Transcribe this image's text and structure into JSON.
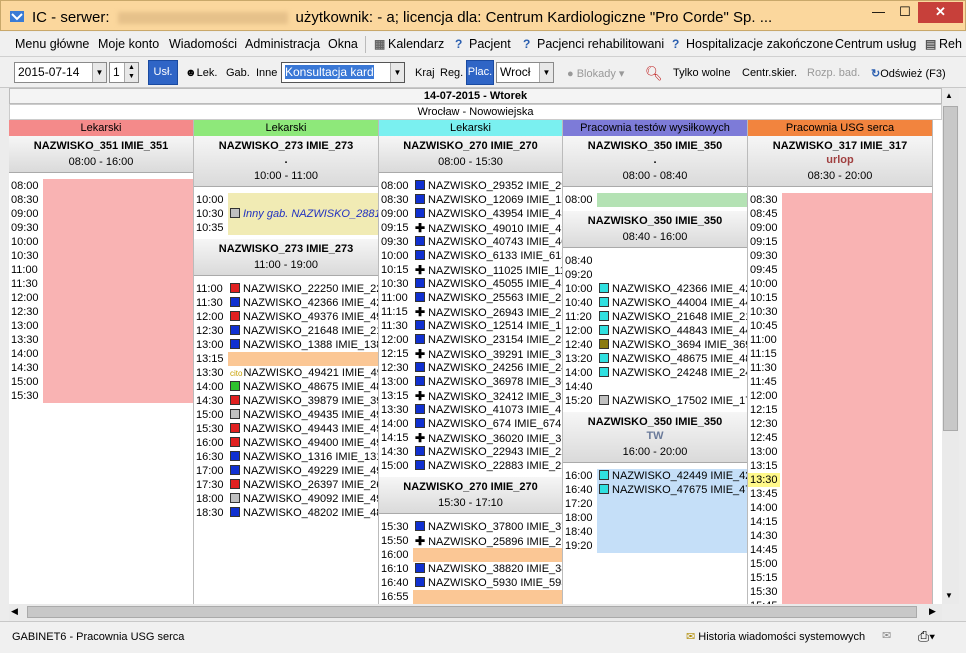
{
  "window": {
    "title_prefix": "IC - serwer:",
    "title_suffix": "użytkownik: - a; licencja dla: Centrum Kardiologiczne \"Pro Corde\" Sp. ...",
    "min_glyph": "—",
    "max_glyph": "☐",
    "close_glyph": "✕"
  },
  "menu": {
    "main": "Menu główne",
    "account": "Moje konto",
    "messages": "Wiadomości",
    "admin": "Administracja",
    "windows": "Okna",
    "calendar": "Kalendarz",
    "patient": "Pacjent",
    "rehab": "Pacjenci rehabilitowani",
    "hosp": "Hospitalizacje zakończone",
    "services": "Centrum usług",
    "more": "Reh"
  },
  "toolbar": {
    "date": "2015-07-14",
    "days": "1",
    "usl": "Usł.",
    "lek": "Lek.",
    "gab": "Gab.",
    "inne": "Inne",
    "service": "Konsultacja  kard",
    "kraj": "Kraj",
    "reg": "Reg.",
    "plac": "Plac.",
    "city": "Wrocł",
    "blokady": "Blokady",
    "tylko_wolne": "Tylko wolne",
    "centr": "Centr.skier.",
    "rozp": "Rozp. bad.",
    "refresh": "Odśwież (F3)"
  },
  "date_header": "14-07-2015 - Wtorek",
  "location": "Wrocław - Nowowiejska",
  "columns": [
    {
      "category": "Lekarski",
      "color": "#f48a8a",
      "sections": [
        {
          "doctor": "NAZWISKO_351 IMIE_351",
          "hours": "08:00 - 16:00",
          "rows": [
            {
              "time": "08:00",
              "bg": "#f9b3b3"
            },
            {
              "time": "08:30",
              "bg": "#f9b3b3"
            },
            {
              "time": "09:00",
              "bg": "#f9b3b3"
            },
            {
              "time": "09:30",
              "bg": "#f9b3b3"
            },
            {
              "time": "10:00",
              "bg": "#f9b3b3"
            },
            {
              "time": "10:30",
              "bg": "#f9b3b3"
            },
            {
              "time": "11:00",
              "bg": "#f9b3b3"
            },
            {
              "time": "11:30",
              "bg": "#f9b3b3"
            },
            {
              "time": "12:00",
              "bg": "#f9b3b3"
            },
            {
              "time": "12:30",
              "bg": "#f9b3b3"
            },
            {
              "time": "13:00",
              "bg": "#f9b3b3"
            },
            {
              "time": "13:30",
              "bg": "#f9b3b3"
            },
            {
              "time": "14:00",
              "bg": "#f9b3b3"
            },
            {
              "time": "14:30",
              "bg": "#f9b3b3"
            },
            {
              "time": "15:00",
              "bg": "#f9b3b3"
            },
            {
              "time": "15:30",
              "bg": "#f9b3b3"
            }
          ]
        }
      ]
    },
    {
      "category": "Lekarski",
      "color": "#8ee87a",
      "sections": [
        {
          "doctor": "NAZWISKO_273 IMIE_273",
          "note": ".",
          "hours": "10:00 - 11:00",
          "rows": [
            {
              "time": "10:00",
              "bg": "#f1ebb4"
            },
            {
              "time": "10:30",
              "bg": "#f1ebb4",
              "icon": "sq",
              "sqc": "#c0c0c0",
              "text": "Inny gab. NAZWISKO_2881",
              "style": "italic-blue"
            },
            {
              "time": "10:35",
              "bg": "#f1ebb4"
            }
          ]
        },
        {
          "doctor": "NAZWISKO_273 IMIE_273",
          "hours": "11:00 - 19:00",
          "rows": [
            {
              "time": "11:00",
              "icon": "sq",
              "sqc": "#e02020",
              "text": "NAZWISKO_22250 IMIE_2225"
            },
            {
              "time": "11:30",
              "icon": "sq",
              "sqc": "#1030d0",
              "text": "NAZWISKO_42366 IMIE_4236"
            },
            {
              "time": "12:00",
              "icon": "sq",
              "sqc": "#e02020",
              "text": "NAZWISKO_49376 IMIE_4937"
            },
            {
              "time": "12:30",
              "icon": "sq",
              "sqc": "#1030d0",
              "text": "NAZWISKO_21648 IMIE_2164"
            },
            {
              "time": "13:00",
              "icon": "sq",
              "sqc": "#1030d0",
              "text": "NAZWISKO_1388 IMIE_1388"
            },
            {
              "time": "13:15",
              "bg": "#fbc795"
            },
            {
              "time": "13:30",
              "icon": "cito",
              "text": "NAZWISKO_49421 IMIE_4942"
            },
            {
              "time": "14:00",
              "icon": "sq",
              "sqc": "#2ec22e",
              "text": "NAZWISKO_48675 IMIE_4867"
            },
            {
              "time": "14:30",
              "icon": "sq",
              "sqc": "#e02020",
              "text": "NAZWISKO_39879 IMIE_3987"
            },
            {
              "time": "15:00",
              "icon": "sq",
              "sqc": "#c0c0c0",
              "text": "NAZWISKO_49435 IMIE_4943"
            },
            {
              "time": "15:30",
              "icon": "sq",
              "sqc": "#e02020",
              "text": "NAZWISKO_49443 IMIE_4944"
            },
            {
              "time": "16:00",
              "icon": "sq",
              "sqc": "#e02020",
              "text": "NAZWISKO_49400 IMIE_4940"
            },
            {
              "time": "16:30",
              "icon": "sq",
              "sqc": "#1030d0",
              "text": "NAZWISKO_1316 IMIE_1316"
            },
            {
              "time": "17:00",
              "icon": "sq",
              "sqc": "#1030d0",
              "text": "NAZWISKO_49229 IMIE_4922"
            },
            {
              "time": "17:30",
              "icon": "sq",
              "sqc": "#e02020",
              "text": "NAZWISKO_26397 IMIE_2639"
            },
            {
              "time": "18:00",
              "icon": "sq",
              "sqc": "#c0c0c0",
              "text": "NAZWISKO_49092 IMIE_4909"
            },
            {
              "time": "18:30",
              "icon": "sq",
              "sqc": "#1030d0",
              "text": "NAZWISKO_48202 IMIE_4820"
            }
          ]
        }
      ]
    },
    {
      "category": "Lekarski",
      "color": "#7af0f0",
      "sections": [
        {
          "doctor": "NAZWISKO_270 IMIE_270",
          "hours": "08:00 - 15:30",
          "rows": [
            {
              "time": "08:00",
              "icon": "sq",
              "sqc": "#1030d0",
              "text": "NAZWISKO_29352 IMIE_2935"
            },
            {
              "time": "08:30",
              "icon": "sq",
              "sqc": "#1030d0",
              "text": "NAZWISKO_12069 IMIE_1206"
            },
            {
              "time": "09:00",
              "icon": "sq",
              "sqc": "#1030d0",
              "text": "NAZWISKO_43954 IMIE_4395"
            },
            {
              "time": "09:15",
              "icon": "plus",
              "text": "NAZWISKO_49010 IMIE_4901"
            },
            {
              "time": "09:30",
              "icon": "sq",
              "sqc": "#1030d0",
              "text": "NAZWISKO_40743 IMIE_4074"
            },
            {
              "time": "10:00",
              "icon": "sq",
              "sqc": "#1030d0",
              "text": "NAZWISKO_6133 IMIE_6133"
            },
            {
              "time": "10:15",
              "icon": "plus",
              "text": "NAZWISKO_11025 IMIE_1102"
            },
            {
              "time": "10:30",
              "icon": "sq",
              "sqc": "#1030d0",
              "text": "NAZWISKO_45055 IMIE_4505"
            },
            {
              "time": "11:00",
              "icon": "sq",
              "sqc": "#1030d0",
              "text": "NAZWISKO_25563 IMIE_2556"
            },
            {
              "time": "11:15",
              "icon": "plus",
              "text": "NAZWISKO_26943 IMIE_2694"
            },
            {
              "time": "11:30",
              "icon": "sq",
              "sqc": "#1030d0",
              "text": "NAZWISKO_12514 IMIE_1251"
            },
            {
              "time": "12:00",
              "icon": "sq",
              "sqc": "#1030d0",
              "text": "NAZWISKO_23154 IMIE_2315"
            },
            {
              "time": "12:15",
              "icon": "plus",
              "text": "NAZWISKO_39291 IMIE_3929"
            },
            {
              "time": "12:30",
              "icon": "sq",
              "sqc": "#1030d0",
              "text": "NAZWISKO_24256 IMIE_2425"
            },
            {
              "time": "13:00",
              "icon": "sq",
              "sqc": "#1030d0",
              "text": "NAZWISKO_36978 IMIE_3697"
            },
            {
              "time": "13:15",
              "icon": "plus",
              "text": "NAZWISKO_32412 IMIE_3241"
            },
            {
              "time": "13:30",
              "icon": "sq",
              "sqc": "#1030d0",
              "text": "NAZWISKO_41073 IMIE_4107"
            },
            {
              "time": "14:00",
              "icon": "sq",
              "sqc": "#1030d0",
              "text": "NAZWISKO_674 IMIE_674"
            },
            {
              "time": "14:15",
              "icon": "plus",
              "text": "NAZWISKO_36020 IMIE_3602"
            },
            {
              "time": "14:30",
              "icon": "sq",
              "sqc": "#1030d0",
              "text": "NAZWISKO_22943 IMIE_2294"
            },
            {
              "time": "15:00",
              "icon": "sq",
              "sqc": "#1030d0",
              "text": "NAZWISKO_22883 IMIE_2288"
            }
          ]
        },
        {
          "doctor": "NAZWISKO_270 IMIE_270",
          "hours": "15:30 - 17:10",
          "rows": [
            {
              "time": "15:30",
              "icon": "sq",
              "sqc": "#1030d0",
              "text": "NAZWISKO_37800 IMIE_3780"
            },
            {
              "time": "15:50",
              "icon": "plus",
              "text": "NAZWISKO_25896 IMIE_2589"
            },
            {
              "time": "16:00",
              "bg": "#fbc795"
            },
            {
              "time": "16:10",
              "icon": "sq",
              "sqc": "#1030d0",
              "text": "NAZWISKO_38820 IMIE_3882"
            },
            {
              "time": "16:40",
              "icon": "sq",
              "sqc": "#1030d0",
              "text": "NAZWISKO_5930 IMIE_5930"
            },
            {
              "time": "16:55",
              "bg": "#fbc795"
            }
          ]
        }
      ]
    },
    {
      "category": "Pracownia testów wysiłkowych",
      "color": "#7d7bd8",
      "sections": [
        {
          "doctor": "NAZWISKO_350 IMIE_350",
          "note": ".",
          "hours": "08:00 - 08:40",
          "rows": [
            {
              "time": "08:00",
              "bg": "#b4e2b4"
            }
          ]
        },
        {
          "doctor": "NAZWISKO_350 IMIE_350",
          "hours": "08:40 - 16:00",
          "rows": [
            {
              "time": "08:40"
            },
            {
              "time": "09:20"
            },
            {
              "time": "10:00",
              "icon": "sq",
              "sqc": "#30e0e0",
              "text": "NAZWISKO_42366 IMIE_4236"
            },
            {
              "time": "10:40",
              "icon": "sq",
              "sqc": "#30e0e0",
              "text": "NAZWISKO_44004 IMIE_4400"
            },
            {
              "time": "11:20",
              "icon": "sq",
              "sqc": "#30e0e0",
              "text": "NAZWISKO_21648 IMIE_2164"
            },
            {
              "time": "12:00",
              "icon": "sq",
              "sqc": "#30e0e0",
              "text": "NAZWISKO_44843 IMIE_4484"
            },
            {
              "time": "12:40",
              "icon": "sq",
              "sqc": "#8a7a10",
              "text": "NAZWISKO_3694 IMIE_3694"
            },
            {
              "time": "13:20",
              "icon": "sq",
              "sqc": "#30e0e0",
              "text": "NAZWISKO_48675 IMIE_4867"
            },
            {
              "time": "14:00",
              "icon": "sq",
              "sqc": "#30e0e0",
              "text": "NAZWISKO_24248 IMIE_2424"
            },
            {
              "time": "14:40"
            },
            {
              "time": "15:20",
              "icon": "sq",
              "sqc": "#c0c0c0",
              "text": "NAZWISKO_17502 IMIE_1750"
            }
          ]
        },
        {
          "doctor": "NAZWISKO_350 IMIE_350",
          "note": "TW",
          "hours": "16:00 - 20:00",
          "rows": [
            {
              "time": "16:00",
              "bg": "#c5dff8",
              "icon": "sq",
              "sqc": "#30e0e0",
              "text": "NAZWISKO_42449 IMIE_4244"
            },
            {
              "time": "16:40",
              "bg": "#c5dff8",
              "icon": "sq",
              "sqc": "#30e0e0",
              "text": "NAZWISKO_47675 IMIE_4767"
            },
            {
              "time": "17:20",
              "bg": "#c5dff8"
            },
            {
              "time": "18:00",
              "bg": "#c5dff8"
            },
            {
              "time": "18:40",
              "bg": "#c5dff8"
            },
            {
              "time": "19:20",
              "bg": "#c5dff8"
            }
          ]
        }
      ]
    },
    {
      "category": "Pracownia USG serca",
      "color": "#f2843e",
      "sections": [
        {
          "doctor": "NAZWISKO_317 IMIE_317",
          "note": "urlop",
          "hours": "08:30 - 20:00",
          "rows": [
            {
              "time": "08:30",
              "bg": "#f9b3b3"
            },
            {
              "time": "08:45",
              "bg": "#f9b3b3"
            },
            {
              "time": "09:00",
              "bg": "#f9b3b3"
            },
            {
              "time": "09:15",
              "bg": "#f9b3b3"
            },
            {
              "time": "09:30",
              "bg": "#f9b3b3"
            },
            {
              "time": "09:45",
              "bg": "#f9b3b3"
            },
            {
              "time": "10:00",
              "bg": "#f9b3b3"
            },
            {
              "time": "10:15",
              "bg": "#f9b3b3"
            },
            {
              "time": "10:30",
              "bg": "#f9b3b3"
            },
            {
              "time": "10:45",
              "bg": "#f9b3b3"
            },
            {
              "time": "11:00",
              "bg": "#f9b3b3"
            },
            {
              "time": "11:15",
              "bg": "#f9b3b3"
            },
            {
              "time": "11:30",
              "bg": "#f9b3b3"
            },
            {
              "time": "11:45",
              "bg": "#f9b3b3"
            },
            {
              "time": "12:00",
              "bg": "#f9b3b3"
            },
            {
              "time": "12:15",
              "bg": "#f9b3b3"
            },
            {
              "time": "12:30",
              "bg": "#f9b3b3"
            },
            {
              "time": "12:45",
              "bg": "#f9b3b3"
            },
            {
              "time": "13:00",
              "bg": "#f9b3b3"
            },
            {
              "time": "13:15",
              "bg": "#f9b3b3"
            },
            {
              "time": "13:30",
              "bg": "#f9b3b3",
              "hl": true
            },
            {
              "time": "13:45",
              "bg": "#f9b3b3"
            },
            {
              "time": "14:00",
              "bg": "#f9b3b3"
            },
            {
              "time": "14:15",
              "bg": "#f9b3b3"
            },
            {
              "time": "14:30",
              "bg": "#f9b3b3"
            },
            {
              "time": "14:45",
              "bg": "#f9b3b3"
            },
            {
              "time": "15:00",
              "bg": "#f9b3b3"
            },
            {
              "time": "15:15",
              "bg": "#f9b3b3"
            },
            {
              "time": "15:30",
              "bg": "#f9b3b3"
            },
            {
              "time": "15:45",
              "bg": "#f9b3b3"
            }
          ]
        }
      ]
    }
  ],
  "status": {
    "left": "GABINET6 - Pracownia USG serca",
    "history": "Historia wiadomości systemowych"
  }
}
